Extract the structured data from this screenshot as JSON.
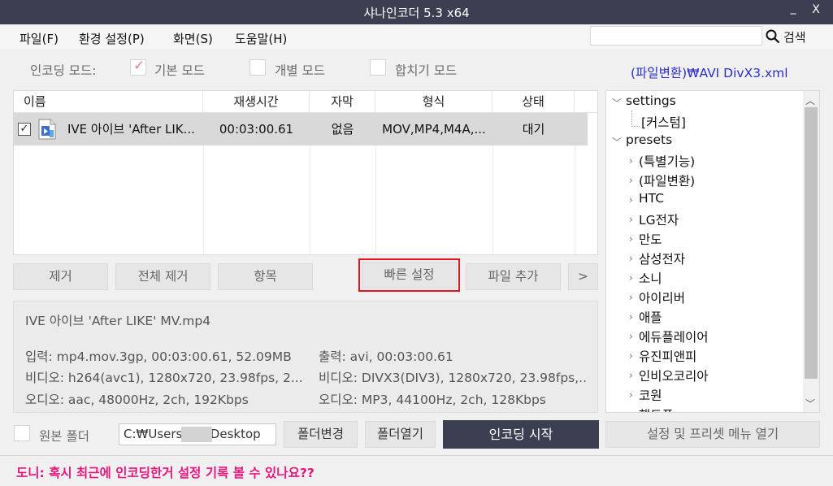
{
  "window": {
    "title": "샤나인코더  5.3 x64",
    "minimize_glyph": "_",
    "close_glyph": "X"
  },
  "menu": {
    "items": [
      "파일(F)",
      "환경 설정(P)",
      "화면(S)",
      "도움말(H)"
    ],
    "search_label": "검색"
  },
  "mode": {
    "label": "인코딩 모드:",
    "options": [
      {
        "label": "기본 모드",
        "checked": true
      },
      {
        "label": "개별 모드",
        "checked": false
      },
      {
        "label": "합치기 모드",
        "checked": false
      }
    ],
    "preset_path": "(파일변환)₩AVI DivX3.xml"
  },
  "file_list": {
    "columns": [
      "이름",
      "재생시간",
      "자막",
      "형식",
      "상태"
    ],
    "rows": [
      {
        "checked": true,
        "name": "IVE 아이브 'After LIK...",
        "duration": "00:03:00.61",
        "subtitle": "없음",
        "format": "MOV,MP4,M4A,...",
        "status": "대기"
      }
    ]
  },
  "actions": {
    "remove": "제거",
    "remove_all": "전체 제거",
    "items": "항목",
    "quick_settings": "빠른 설정",
    "add_file": "파일 추가",
    "more": ">"
  },
  "info": {
    "filename": "IVE 아이브 'After LIKE' MV.mp4",
    "input": "입력: mp4.mov.3gp, 00:03:00.61, 52.09MB",
    "video_in": "비디오: h264(avc1), 1280x720, 23.98fps, 2...",
    "audio_in": "오디오: aac, 48000Hz, 2ch, 192Kbps",
    "output": "출력: avi, 00:03:00.61",
    "video_out": "비디오: DIVX3(DIV3), 1280x720, 23.98fps,...",
    "audio_out": "오디오: MP3, 44100Hz, 2ch, 128Kbps"
  },
  "tree": {
    "root_settings": "settings",
    "custom": "[커스텀]",
    "root_presets": "presets",
    "presets": [
      "(특별기능)",
      "(파일변환)",
      "HTC",
      "LG전자",
      "만도",
      "삼성전자",
      "소니",
      "아이리버",
      "애플",
      "에듀플레이어",
      "유진피앤피",
      "인비오코리아",
      "코원",
      "핸드폰"
    ]
  },
  "bottom": {
    "source_folder_label": "원본 폴더",
    "path": "C:₩Users₩        ₩Desktop",
    "change_folder": "폴더변경",
    "open_folder": "폴더열기",
    "start_encoding": "인코딩 시작",
    "settings_menu": "설정 및 프리셋 메뉴 열기"
  },
  "status_message": "도니: 혹시 최근에 인코딩한거 설정 기록 볼 수 있나요??"
}
